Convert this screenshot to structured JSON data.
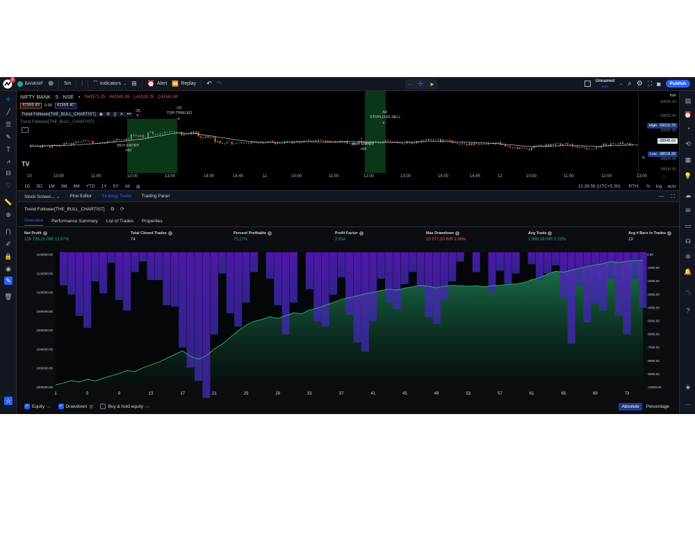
{
  "topbar": {
    "notif_badge": "9",
    "symbol": "BANKNIF",
    "interval": "5m",
    "indicators": "Indicators",
    "alert": "Alert",
    "replay": "Replay",
    "layout_name": "Unnamed",
    "layout_sub": "Save",
    "publish": "Publish"
  },
  "chart": {
    "symbol_title": "NIFTY BANK · 5 · NSE",
    "ohlc": {
      "o": "O41571.25",
      "h": "H41581.95",
      "l": "L41529.25",
      "c": "C41542.60"
    },
    "sell_price": "41559.40",
    "spread": "0.00",
    "buy_price": "41559.40",
    "indicator1": "Trend Follower[THE_BULL_CHARTIST]",
    "indicator2": "Trend Follower[THE_BULL_CHARTIST]",
    "currency": "INR",
    "annotations": {
      "a1": "-25",
      "a2": "-23",
      "a2b": "TOP-TRAILED",
      "a3": "BUY ENTRY",
      "a3b": "+50",
      "a4": "-50",
      "a4b": "STOPLOSS SELL",
      "a5": "BUY ENTRY",
      "a5b": "+50"
    },
    "price_labels": [
      "40000.00",
      "39600.00",
      "39000.00",
      "38600.00",
      "38000.00"
    ],
    "high_tag": "High",
    "high_val": "39315.70",
    "cur_val": "38848.60",
    "low_tag": "Low",
    "low_val": "38518.30",
    "time_labels": [
      "10",
      "10:00",
      "11:00",
      "12:00",
      "13:00",
      "14:00",
      "14:45",
      "11",
      "10:00",
      "11:00",
      "12:00",
      "13:00",
      "14:00",
      "14:45",
      "12",
      "10:00",
      "11:00",
      "12:00",
      "13:00"
    ],
    "tv_logo": "TV"
  },
  "range_bar": {
    "ranges": [
      "1D",
      "5D",
      "1M",
      "3M",
      "6M",
      "YTD",
      "1Y",
      "5Y",
      "All"
    ],
    "clock": "13:39:59 (UTC+5:30)",
    "rth": "RTH",
    "pct": "%",
    "log": "log",
    "auto": "auto"
  },
  "panel_tabs": [
    "Stock Screen...",
    "Pine Editor",
    "Strategy Tester",
    "Trading Panel"
  ],
  "strategy": {
    "name": "Trend Follower[THE_BULL_CHARTIST]",
    "subtabs": [
      "Overview",
      "Performance Summary",
      "List of Trades",
      "Properties"
    ],
    "metrics": [
      {
        "label": "Net Profit",
        "value": "139 726.25 INR  13.97%",
        "color": "#26a69a"
      },
      {
        "label": "Total Closed Trades",
        "value": "74",
        "color": "#d1d4dc"
      },
      {
        "label": "Percent Profitable",
        "value": "70.27%",
        "color": "#26a69a"
      },
      {
        "label": "Profit Factor",
        "value": "2.914",
        "color": "#26a69a"
      },
      {
        "label": "Max Drawdown",
        "value": "10 977.50 INR  1.06%",
        "color": "#ef5350"
      },
      {
        "label": "Avg Trade",
        "value": "1 888.19 INR  0.23%",
        "color": "#26a69a"
      },
      {
        "label": "Avg # Bars in Trades",
        "value": "19",
        "color": "#d1d4dc"
      }
    ],
    "equity_left_labels": [
      "1140000.00",
      "1120000.00",
      "1100000.00",
      "1080000.00",
      "1060000.00",
      "1040000.00",
      "1020000.00",
      "1000000.00"
    ],
    "drawdown_right_labels": [
      "0.00",
      "-1000.00",
      "-2000.00",
      "-3000.00",
      "-4000.00",
      "-5000.00",
      "-6000.00",
      "-7000.00",
      "-8000.00",
      "-9000.00",
      "-10000.00"
    ],
    "trade_axis": [
      "1",
      "5",
      "9",
      "13",
      "17",
      "21",
      "25",
      "29",
      "33",
      "37",
      "41",
      "45",
      "49",
      "53",
      "57",
      "61",
      "65",
      "69",
      "73"
    ],
    "legend": {
      "equity": "Equity",
      "drawdown": "Drawdown",
      "buyhold": "Buy & hold equity"
    },
    "absolute": "Absolute",
    "percentage": "Percentage"
  },
  "chart_data": {
    "type": "area",
    "x": [
      1,
      2,
      3,
      4,
      5,
      6,
      7,
      8,
      9,
      10,
      11,
      12,
      13,
      14,
      15,
      16,
      17,
      18,
      19,
      20,
      21,
      22,
      23,
      24,
      25,
      26,
      27,
      28,
      29,
      30,
      31,
      32,
      33,
      34,
      35,
      36,
      37,
      38,
      39,
      40,
      41,
      42,
      43,
      44,
      45,
      46,
      47,
      48,
      49,
      50,
      51,
      52,
      53,
      54,
      55,
      56,
      57,
      58,
      59,
      60,
      61,
      62,
      63,
      64,
      65,
      66,
      67,
      68,
      69,
      70,
      71,
      72,
      73,
      74,
      75
    ],
    "series": [
      {
        "name": "Equity",
        "values": [
          1000000,
          1002000,
          1004500,
          1003000,
          1006000,
          1004000,
          1007000,
          1009500,
          1012000,
          1015000,
          1014000,
          1018000,
          1021000,
          1024000,
          1028000,
          1032000,
          1036000,
          1030000,
          1027000,
          1031000,
          1038000,
          1043000,
          1050000,
          1057000,
          1063000,
          1067000,
          1069000,
          1072000,
          1070000,
          1073000,
          1076000,
          1075000,
          1079000,
          1081000,
          1084000,
          1087000,
          1090000,
          1092000,
          1094000,
          1096000,
          1097500,
          1099500,
          1101000,
          1100000,
          1102000,
          1103500,
          1105000,
          1104000,
          1102500,
          1104000,
          1105000,
          1104500,
          1104000,
          1104500,
          1103500,
          1104500,
          1105000,
          1106000,
          1106500,
          1108000,
          1111000,
          1113000,
          1117000,
          1120000,
          1119000,
          1121000,
          1123000,
          1125000,
          1126500,
          1128000,
          1130000,
          1129000,
          1130500,
          1131000,
          1131500
        ]
      },
      {
        "name": "Drawdown",
        "values": [
          0,
          -2500,
          -3200,
          -4800,
          -5700,
          -2200,
          -3100,
          -800,
          -3600,
          -4400,
          -1500,
          -700,
          -2100,
          -2100,
          -4000,
          -4100,
          -7200,
          -8700,
          -9700,
          -10977,
          -6200,
          -1600,
          -4600,
          -5600,
          -3800,
          -1500,
          0,
          -2000,
          -4000,
          -6200,
          -3800,
          0,
          -2800,
          -5200,
          -5600,
          -3200,
          -1900,
          -4700,
          -6800,
          -7500,
          -5200,
          -2000,
          -3800,
          -4300,
          -2400,
          -1500,
          -2700,
          -4900,
          -5400,
          -3600,
          -2200,
          -700,
          0,
          -1500,
          0,
          -3000,
          -1400,
          -2400,
          -1600,
          0,
          -900,
          -2100,
          -1600,
          -1000,
          -3500,
          -6900,
          -2500,
          -5300,
          -3900,
          -4400,
          -2000,
          -4800,
          -6200,
          -2000,
          -4200
        ]
      }
    ],
    "xlabel": "",
    "ylabel": "",
    "ylim": [
      1000000,
      1140000
    ],
    "y2lim": [
      -10000,
      0
    ],
    "grid": false,
    "legend": "bottom-left"
  }
}
